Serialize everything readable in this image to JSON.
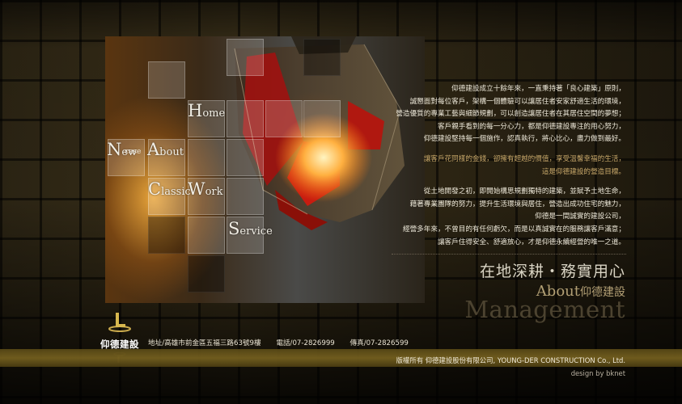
{
  "nav": {
    "home": {
      "cap": "H",
      "rest": "ome"
    },
    "news": {
      "cap": "N",
      "rest": "ew"
    },
    "news_sub": "case",
    "about": {
      "cap": "A",
      "rest": "bout"
    },
    "classic": {
      "cap": "C",
      "rest": "lassic"
    },
    "work": {
      "cap": "W",
      "rest": "ork"
    },
    "service": {
      "cap": "S",
      "rest": "ervice"
    }
  },
  "intro": {
    "para1": [
      "仰德建設成立十餘年來，一直秉持著「良心建築」原則，",
      "誠懇面對每位客戶，架構一個體驗可以讓居住者安家舒適生活的環境，",
      "營造優質的專業工藝與細節規劃，可以創造讓居住者在其居住空間的夢想；",
      "客戶親手看到的每一分心力，都是仰德建設專注的用心努力，",
      "仰德建設堅持每一個施作，認真執行，將心比心，盡力做到最好。"
    ],
    "para2": [
      "讓客戶花同樣的金錢，卻擁有超越的價值，享受溫馨幸福的生活，",
      "這是仰德建設的營造目標。"
    ],
    "para3": [
      "從土地開發之初，即開始構思規劃獨特的建築，並賦予土地生命，",
      "藉著專業團隊的努力，提升生活環境與居住，營造出成功住宅的魅力，",
      "仰德是一間誠實的建設公司，",
      "經營多年來，不曾目的有任何虧欠，而是以真誠實在的服務讓客戶滿意；",
      "讓客戶住得安全、舒適放心，才是仰德永續經營的唯一之道。"
    ]
  },
  "slogan": "在地深耕・務實用心",
  "about_heading": {
    "en": "About",
    "zh": "仰德建設"
  },
  "management": "Management",
  "brand": {
    "name": "仰德建設"
  },
  "footer": {
    "address": "地址/高雄市前金區五福三路63號9樓",
    "phone": "電話/07-2826999",
    "fax": "傳真/07-2826599",
    "copyright": "版權所有 仰德建設股份有限公司, YOUNG-DER CONSTRUCTION Co., Ltd.",
    "credit": "design by bknet"
  },
  "colors": {
    "accent_gold": "#b29f74",
    "band": "#6a561a",
    "lamp_red": "#c11a10"
  }
}
